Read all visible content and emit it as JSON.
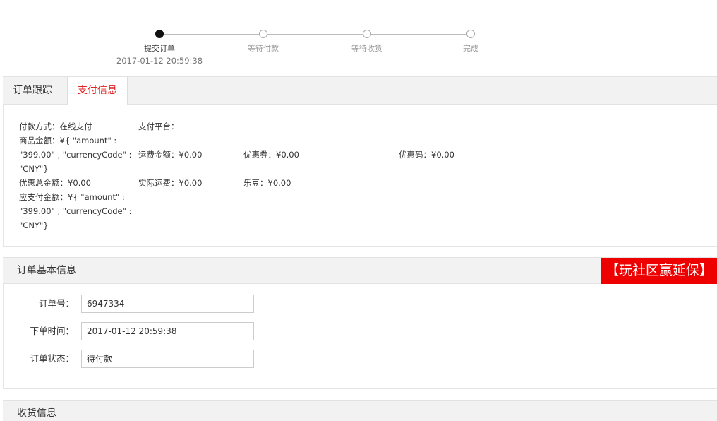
{
  "progress": {
    "steps": [
      {
        "label": "提交订单",
        "time": "2017-01-12 20:59:38",
        "active": true
      },
      {
        "label": "等待付款",
        "time": "",
        "active": false
      },
      {
        "label": "等待收货",
        "time": "",
        "active": false
      },
      {
        "label": "完成",
        "time": "",
        "active": false
      }
    ]
  },
  "tabs": {
    "tracking": "订单跟踪",
    "payment": "支付信息"
  },
  "payment": {
    "method_label": "付款方式：",
    "method_value": "在线支付",
    "platform_label": "支付平台：",
    "goods_amount_line1": "商品金额：¥{ \"amount\" :",
    "goods_amount_line2": "\"399.00\" , \"currencyCode\" :",
    "goods_amount_line3": "\"CNY\"}",
    "shipping_fee": "运费金额：¥0.00",
    "coupon": "优惠券：¥0.00",
    "promo_code": "优惠码：¥0.00",
    "discount_total": "优惠总金额：¥0.00",
    "actual_shipping": "实际运费：¥0.00",
    "ledou": "乐豆：¥0.00",
    "payable_line1": "应支付金额：¥{ \"amount\" :",
    "payable_line2": "\"399.00\" , \"currencyCode\" :",
    "payable_line3": "\"CNY\"}"
  },
  "basic_info": {
    "title": "订单基本信息",
    "promo_badge": "【玩社区赢延保】",
    "order_no_label": "订单号：",
    "order_no": "6947334",
    "order_time_label": "下单时间：",
    "order_time": "2017-01-12 20:59:38",
    "status_label": "订单状态：",
    "status": "待付款"
  },
  "shipping_info": {
    "title": "收货信息"
  },
  "colors": {
    "accent": "#dd2222",
    "promo_bg": "#ee0000",
    "header_bg": "#f2f2f2"
  }
}
